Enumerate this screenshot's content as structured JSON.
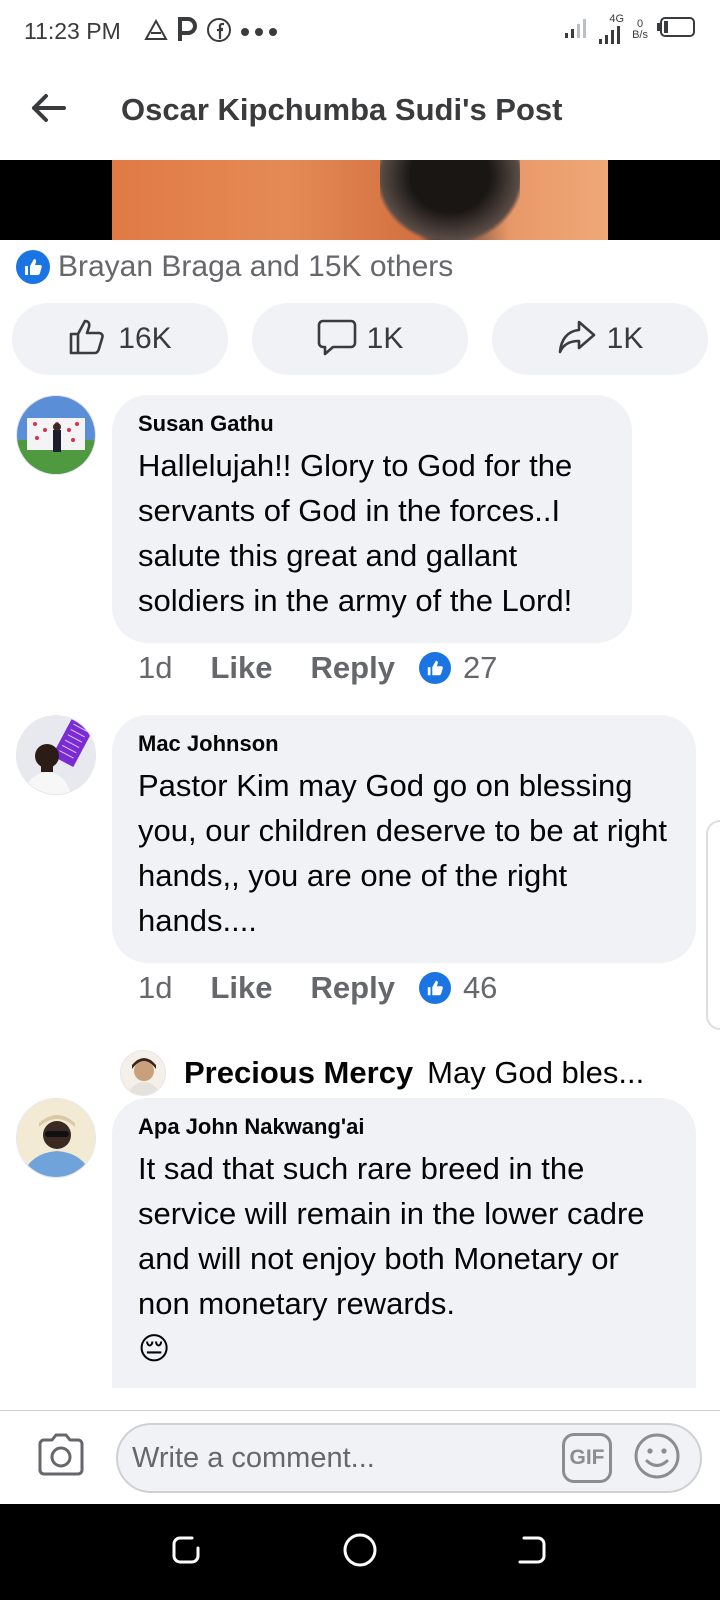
{
  "status_bar": {
    "time": "11:23 PM",
    "network_type": "4G",
    "data_rate_value": "0",
    "data_rate_unit": "B/s",
    "left_icons": [
      "alert-triangle-icon",
      "p-app-icon",
      "facebook-icon",
      "more-dots-icon"
    ],
    "right_icons": [
      "signal-icon",
      "signal-4g-icon",
      "battery-icon"
    ]
  },
  "header": {
    "title": "Oscar Kipchumba Sudi's Post"
  },
  "reactions": {
    "summary": "Brayan Braga and 15K others"
  },
  "actions": {
    "like_count": "16K",
    "comment_count": "1K",
    "share_count": "1K"
  },
  "comments": [
    {
      "author": "Susan Gathu",
      "text": "Hallelujah!! Glory to God for the servants of God in the forces..I salute this great and gallant soldiers in the army of the Lord!",
      "time": "1d",
      "like_label": "Like",
      "reply_label": "Reply",
      "reactions": "27"
    },
    {
      "author": "Mac Johnson",
      "text": "Pastor Kim may God go on blessing you, our children deserve to be at right hands,, you are one of the right hands....",
      "time": "1d",
      "like_label": "Like",
      "reply_label": "Reply",
      "reactions": "46"
    },
    {
      "author": "Apa John Nakwang'ai",
      "text": "It sad that such rare breed in the service will remain in the lower cadre and will not enjoy both Monetary or non monetary rewards.",
      "emoji": "😔"
    }
  ],
  "reply_preview": {
    "author": "Precious Mercy",
    "text": "May God bles..."
  },
  "composer": {
    "placeholder": "Write a comment...",
    "gif_label": "GIF"
  },
  "colors": {
    "facebook_blue": "#1b74e4",
    "bubble_bg": "#f0f2f5",
    "secondary_text": "#65676b"
  }
}
